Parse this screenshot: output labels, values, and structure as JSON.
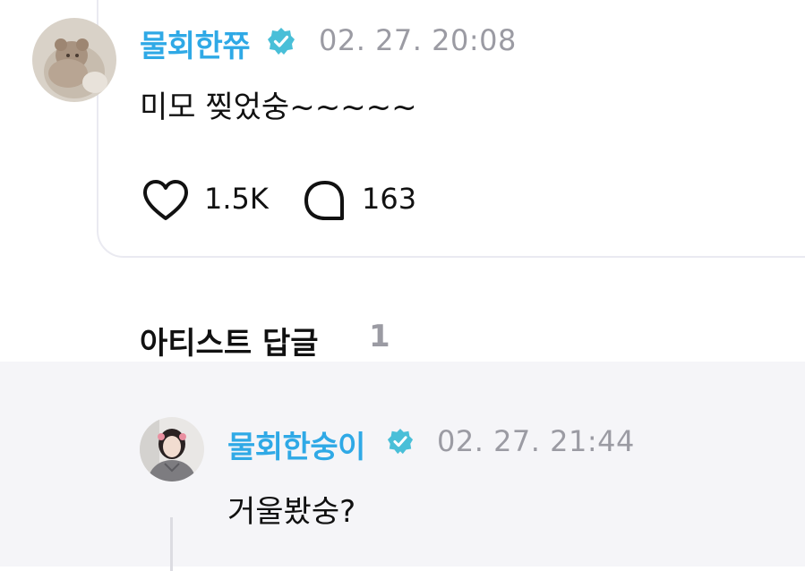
{
  "post": {
    "author": "물회한쮸",
    "timestamp": "02. 27. 20:08",
    "text": "미모 찢었숭~~~~~",
    "like_count": "1.5K",
    "comment_count": "163"
  },
  "section": {
    "title": "아티스트 답글",
    "count": "1"
  },
  "reply": {
    "author": "물회한숭이",
    "timestamp": "02. 27. 21:44",
    "text": "거울봤숭?"
  },
  "colors": {
    "author_name": "#2fa9e6",
    "verified_badge": "#49bfd8",
    "muted": "#9b9ba3",
    "reply_background": "#f5f5f8"
  },
  "icons": {
    "verified": "verified-badge-icon",
    "like": "heart-outline-icon",
    "comment": "speech-bubble-icon"
  }
}
